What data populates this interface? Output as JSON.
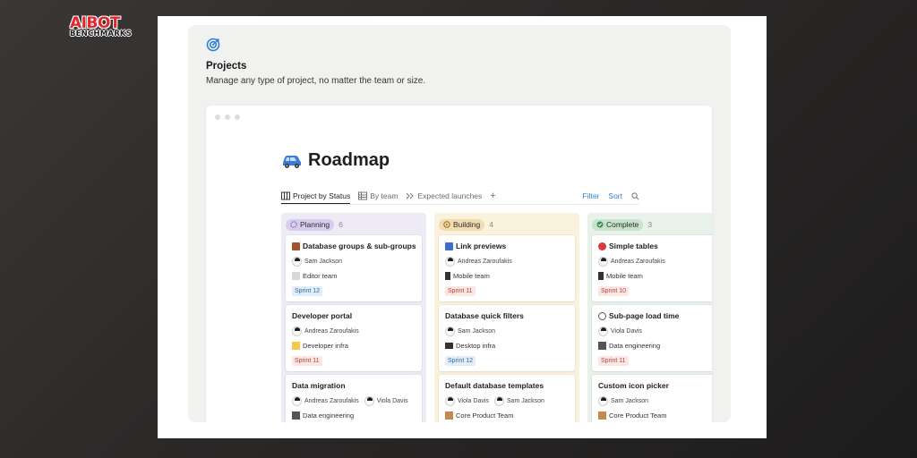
{
  "brand": {
    "logo_text_top": "AIBOT",
    "logo_text_bottom": "BENCHMARKS"
  },
  "template_card": {
    "icon": "target-icon",
    "title": "Projects",
    "description": "Manage any type of project, no matter the team or size."
  },
  "roadmap": {
    "title": "Roadmap",
    "title_icon": "car-icon",
    "tabs": [
      {
        "label": "Project by Status",
        "icon": "board-icon",
        "active": true
      },
      {
        "label": "By team",
        "icon": "table-icon",
        "active": false
      },
      {
        "label": "Expected launches",
        "icon": "timeline-icon",
        "active": false
      }
    ],
    "add_view": "+",
    "filter_label": "Filter",
    "sort_label": "Sort",
    "columns": [
      {
        "status": "Planning",
        "count": "6",
        "color": "#d9cdee",
        "cards": [
          {
            "title": "Database groups & sub-groups",
            "people": [
              "Sam Jackson"
            ],
            "team": "Editor team",
            "sprint": "Sprint 12"
          },
          {
            "title": "Developer portal",
            "people": [
              "Andreas Zaroufakis"
            ],
            "team": "Developer infra",
            "sprint": "Sprint 11"
          },
          {
            "title": "Data migration",
            "people": [
              "Andreas Zaroufakis",
              "Viola Davis"
            ],
            "team": "Data engineering",
            "sprint": ""
          }
        ]
      },
      {
        "status": "Building",
        "count": "4",
        "color": "#f0dcb0",
        "cards": [
          {
            "title": "Link previews",
            "people": [
              "Andreas Zaroufakis"
            ],
            "team": "Mobile team",
            "sprint": "Sprint 11"
          },
          {
            "title": "Database quick filters",
            "people": [
              "Sam Jackson"
            ],
            "team": "Desktop infra",
            "sprint": "Sprint 12"
          },
          {
            "title": "Default database templates",
            "people": [
              "Viola Davis",
              "Sam Jackson"
            ],
            "team": "Core Product Team",
            "sprint": ""
          }
        ]
      },
      {
        "status": "Complete",
        "count": "3",
        "color": "#c7e3cc",
        "cards": [
          {
            "title": "Simple tables",
            "people": [
              "Andreas Zaroufakis"
            ],
            "team": "Mobile team",
            "sprint": "Sprint 10"
          },
          {
            "title": "Sub-page load time",
            "people": [
              "Viola Davis"
            ],
            "team": "Data engineering",
            "sprint": "Sprint 11"
          },
          {
            "title": "Custom icon picker",
            "people": [
              "Sam Jackson"
            ],
            "team": "Core Product Team",
            "sprint": ""
          }
        ]
      }
    ]
  }
}
